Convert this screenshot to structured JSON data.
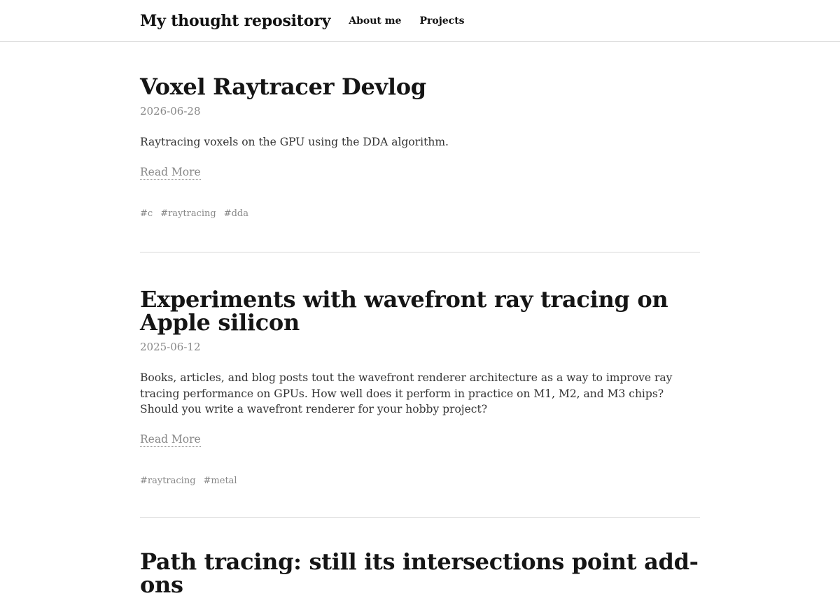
{
  "header": {
    "site_title": "My thought repository",
    "nav": [
      {
        "label": "About me"
      },
      {
        "label": "Projects"
      }
    ]
  },
  "posts": [
    {
      "title": "Voxel Raytracer Devlog",
      "date": "2026-06-28",
      "excerpt": "Raytracing voxels on the GPU using the DDA algorithm.",
      "read_more": "Read More",
      "tags": [
        "#c",
        "#raytracing",
        "#dda"
      ]
    },
    {
      "title": "Experiments with wavefront ray tracing on Apple silicon",
      "date": "2025-06-12",
      "excerpt": "Books, articles, and blog posts tout the wavefront renderer architecture as a way to improve ray tracing performance on GPUs. How well does it perform in practice on M1, M2, and M3 chips? Should you write a wavefront renderer for your hobby project?",
      "read_more": "Read More",
      "tags": [
        "#raytracing",
        "#metal"
      ]
    },
    {
      "title": "Path tracing: still its intersections point add-ons"
    }
  ]
}
